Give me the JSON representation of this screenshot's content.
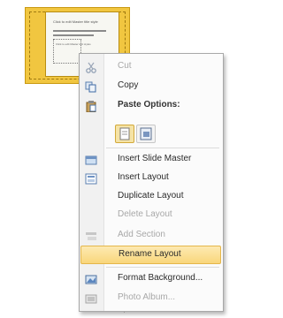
{
  "thumbnail": {
    "title": "Click to edit Master title style",
    "lines_text": "Click to edit Master text styles"
  },
  "menu": {
    "cut": "Cut",
    "copy": "Copy",
    "paste_options": "Paste Options:",
    "insert_slide_master": "Insert Slide Master",
    "insert_layout": "Insert Layout",
    "duplicate_layout": "Duplicate Layout",
    "delete_layout": "Delete Layout",
    "add_section": "Add Section",
    "rename_layout": "Rename Layout",
    "format_background": "Format Background...",
    "photo_album": "Photo Album..."
  },
  "colors": {
    "thumb_bg": "#f1c640",
    "highlight": "#f9d67b"
  }
}
